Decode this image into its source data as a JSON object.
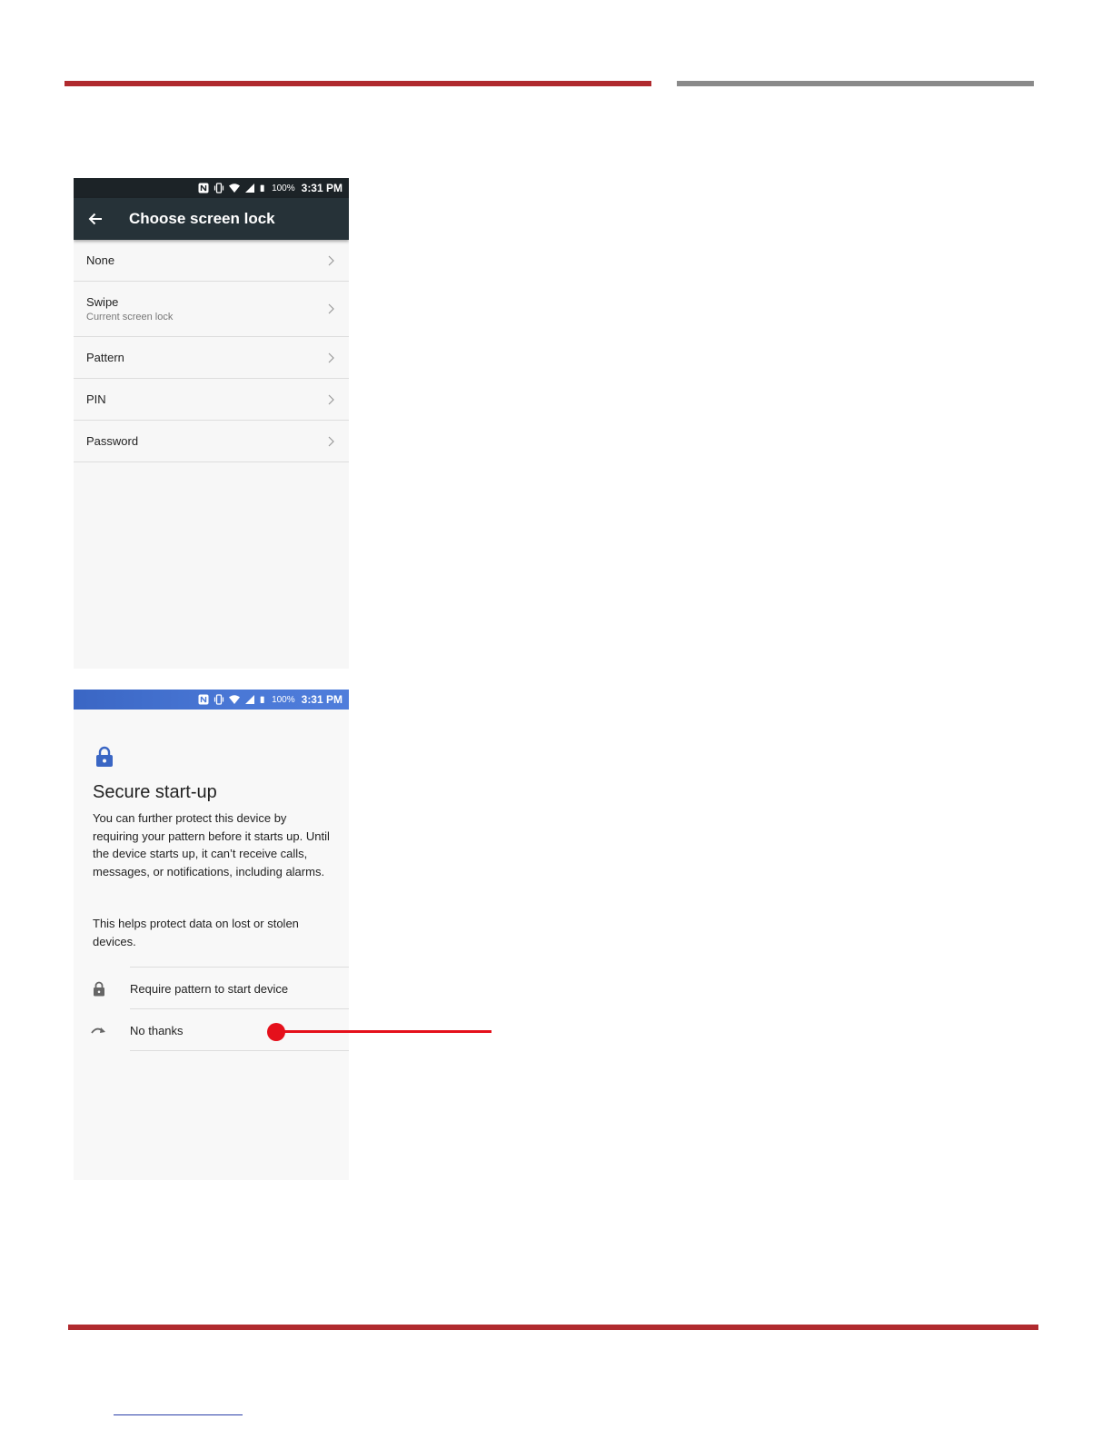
{
  "colors": {
    "rule_red": "#b02a2e",
    "rule_gray": "#8a8a8a",
    "appbar": "#263238",
    "statusbar_dark": "#1c2327",
    "statusbar_blue": "#4a78d6",
    "accent_blue": "#3a66c4",
    "callout": "#e5101b"
  },
  "screen1": {
    "status": {
      "battery": "100%",
      "time": "3:31 PM",
      "icons": [
        "nfc-icon",
        "vibrate-icon",
        "wifi-icon",
        "signal-icon",
        "battery-icon"
      ]
    },
    "title": "Choose screen lock",
    "options": [
      {
        "label": "None"
      },
      {
        "label": "Swipe",
        "subtitle": "Current screen lock"
      },
      {
        "label": "Pattern"
      },
      {
        "label": "PIN"
      },
      {
        "label": "Password"
      }
    ]
  },
  "screen2": {
    "status": {
      "battery": "100%",
      "time": "3:31 PM"
    },
    "heading": "Secure start-up",
    "body1": "You can further protect this device by requiring your pattern before it starts up. Until the device starts up, it can’t receive calls, messages, or notifications, including alarms.",
    "body2": "This helps protect data on lost or stolen devices.",
    "options": [
      {
        "label": "Require pattern to start device",
        "icon": "lock-icon"
      },
      {
        "label": "No thanks",
        "icon": "skip-arrow-icon"
      }
    ]
  }
}
